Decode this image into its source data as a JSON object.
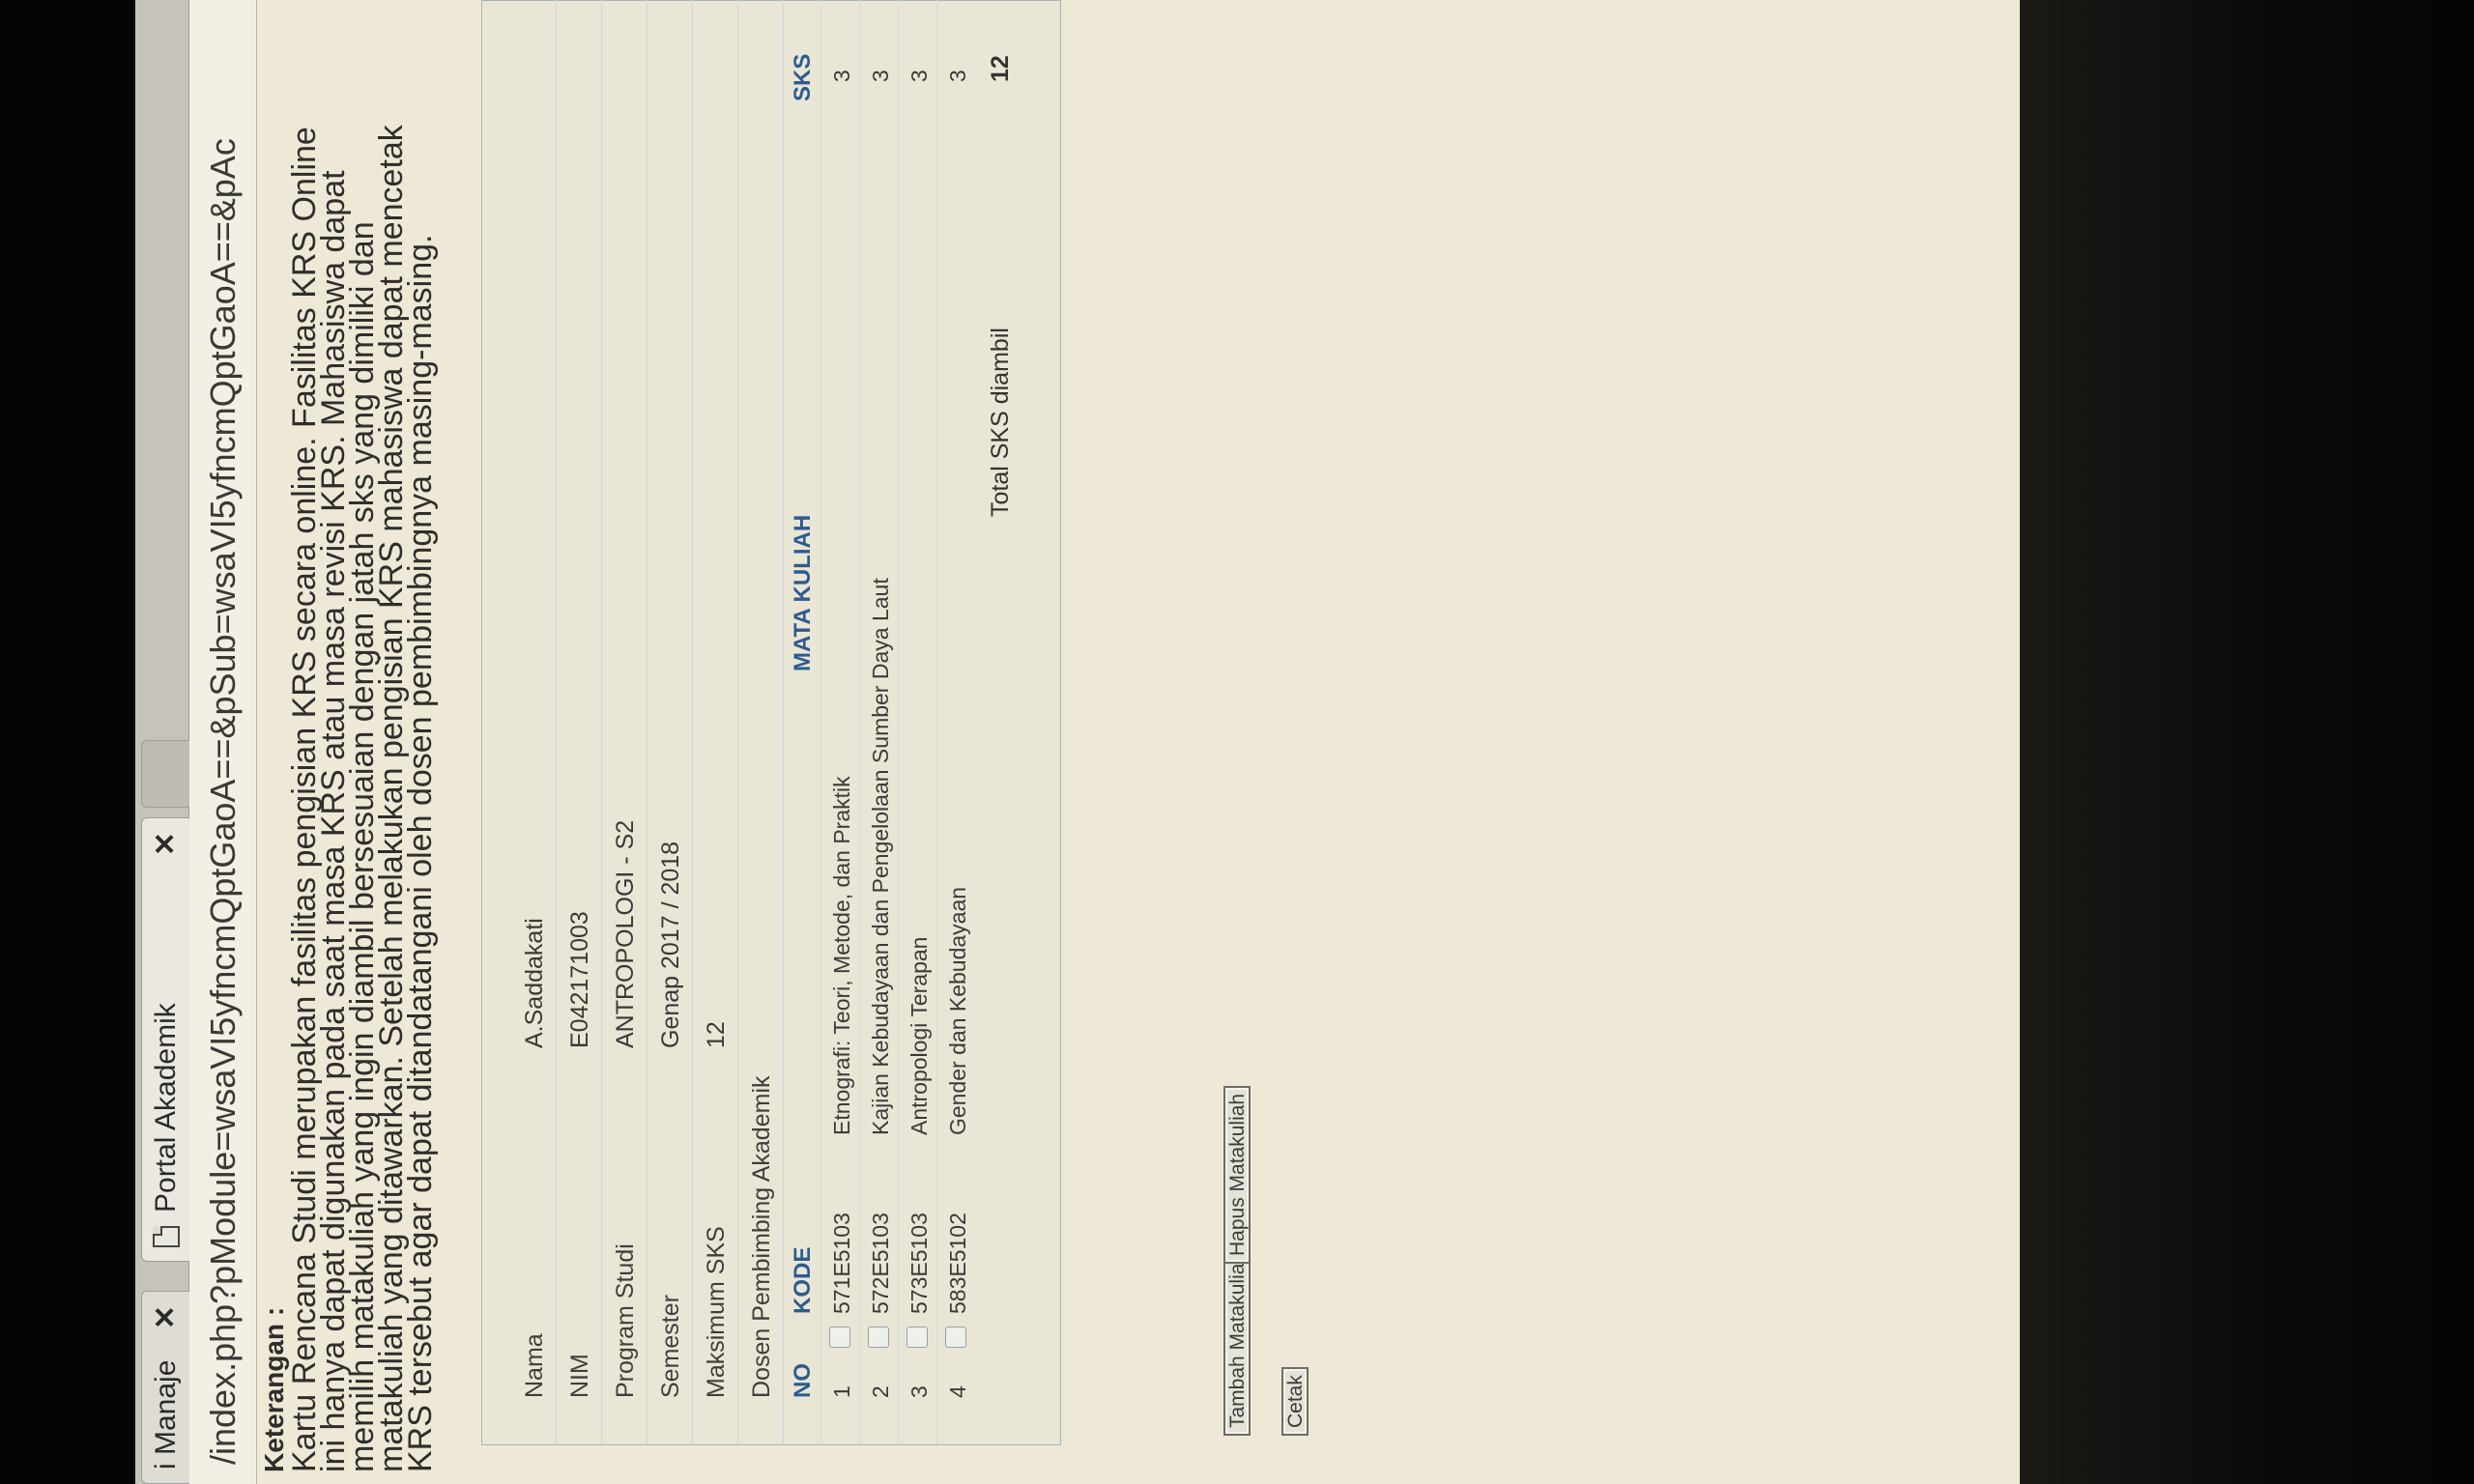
{
  "browser": {
    "tabs": [
      {
        "label": "i Manaje",
        "close": "✕"
      },
      {
        "label": "Portal Akademik",
        "close": "✕"
      }
    ],
    "url": "/index.php?pModule=wsaVI5yfncmQptGaoA==&pSub=wsaVI5yfncmQptGaoA==&pAc"
  },
  "keterangan": {
    "title": "Keterangan :",
    "body": "Kartu Rencana Studi merupakan fasilitas pengisian KRS secara online. Fasilitas KRS Online ini hanya dapat digunakan pada saat masa KRS atau masa revisi KRS. Mahasiswa dapat memilih matakuliah yang ingin diambil bersesuaian dengan jatah sks yang dimiliki dan matakuliah yang ditawarkan. Setelah melakukan pengisian KRS mahasiswa dapat mencetak KRS tersebut agar dapat ditandatangani oleh dosen pembimbingnya masing-masing."
  },
  "student": {
    "nama_label": "Nama",
    "nama": "A.Saddakati",
    "nim_label": "NIM",
    "nim": "E042171003",
    "prodi_label": "Program Studi",
    "prodi": "ANTROPOLOGI - S2",
    "semester_label": "Semester",
    "semester": "Genap 2017 / 2018",
    "maks_label": "Maksimum SKS",
    "maks": "12",
    "dosen_label": "Dosen Pembimbing Akademik",
    "dosen": ""
  },
  "courses": {
    "headers": {
      "no": "NO",
      "kode": "KODE",
      "mata_kuliah": "MATA KULIAH",
      "sks": "SKS"
    },
    "rows": [
      {
        "no": "1",
        "kode": "571E5103",
        "nama": "Etnografi: Teori, Metode, dan Praktik",
        "sks": "3"
      },
      {
        "no": "2",
        "kode": "572E5103",
        "nama": "Kajian Kebudayaan dan Pengelolaan Sumber Daya Laut",
        "sks": "3"
      },
      {
        "no": "3",
        "kode": "573E5103",
        "nama": "Antropologi Terapan",
        "sks": "3"
      },
      {
        "no": "4",
        "kode": "583E5102",
        "nama": "Gender dan Kebudayaan",
        "sks": "3"
      }
    ],
    "total_label": "Total SKS diambil",
    "total": "12"
  },
  "buttons": {
    "tambah": "Tambah Matakuliah",
    "hapus": "Hapus Matakuliah",
    "cetak": "Cetak"
  }
}
